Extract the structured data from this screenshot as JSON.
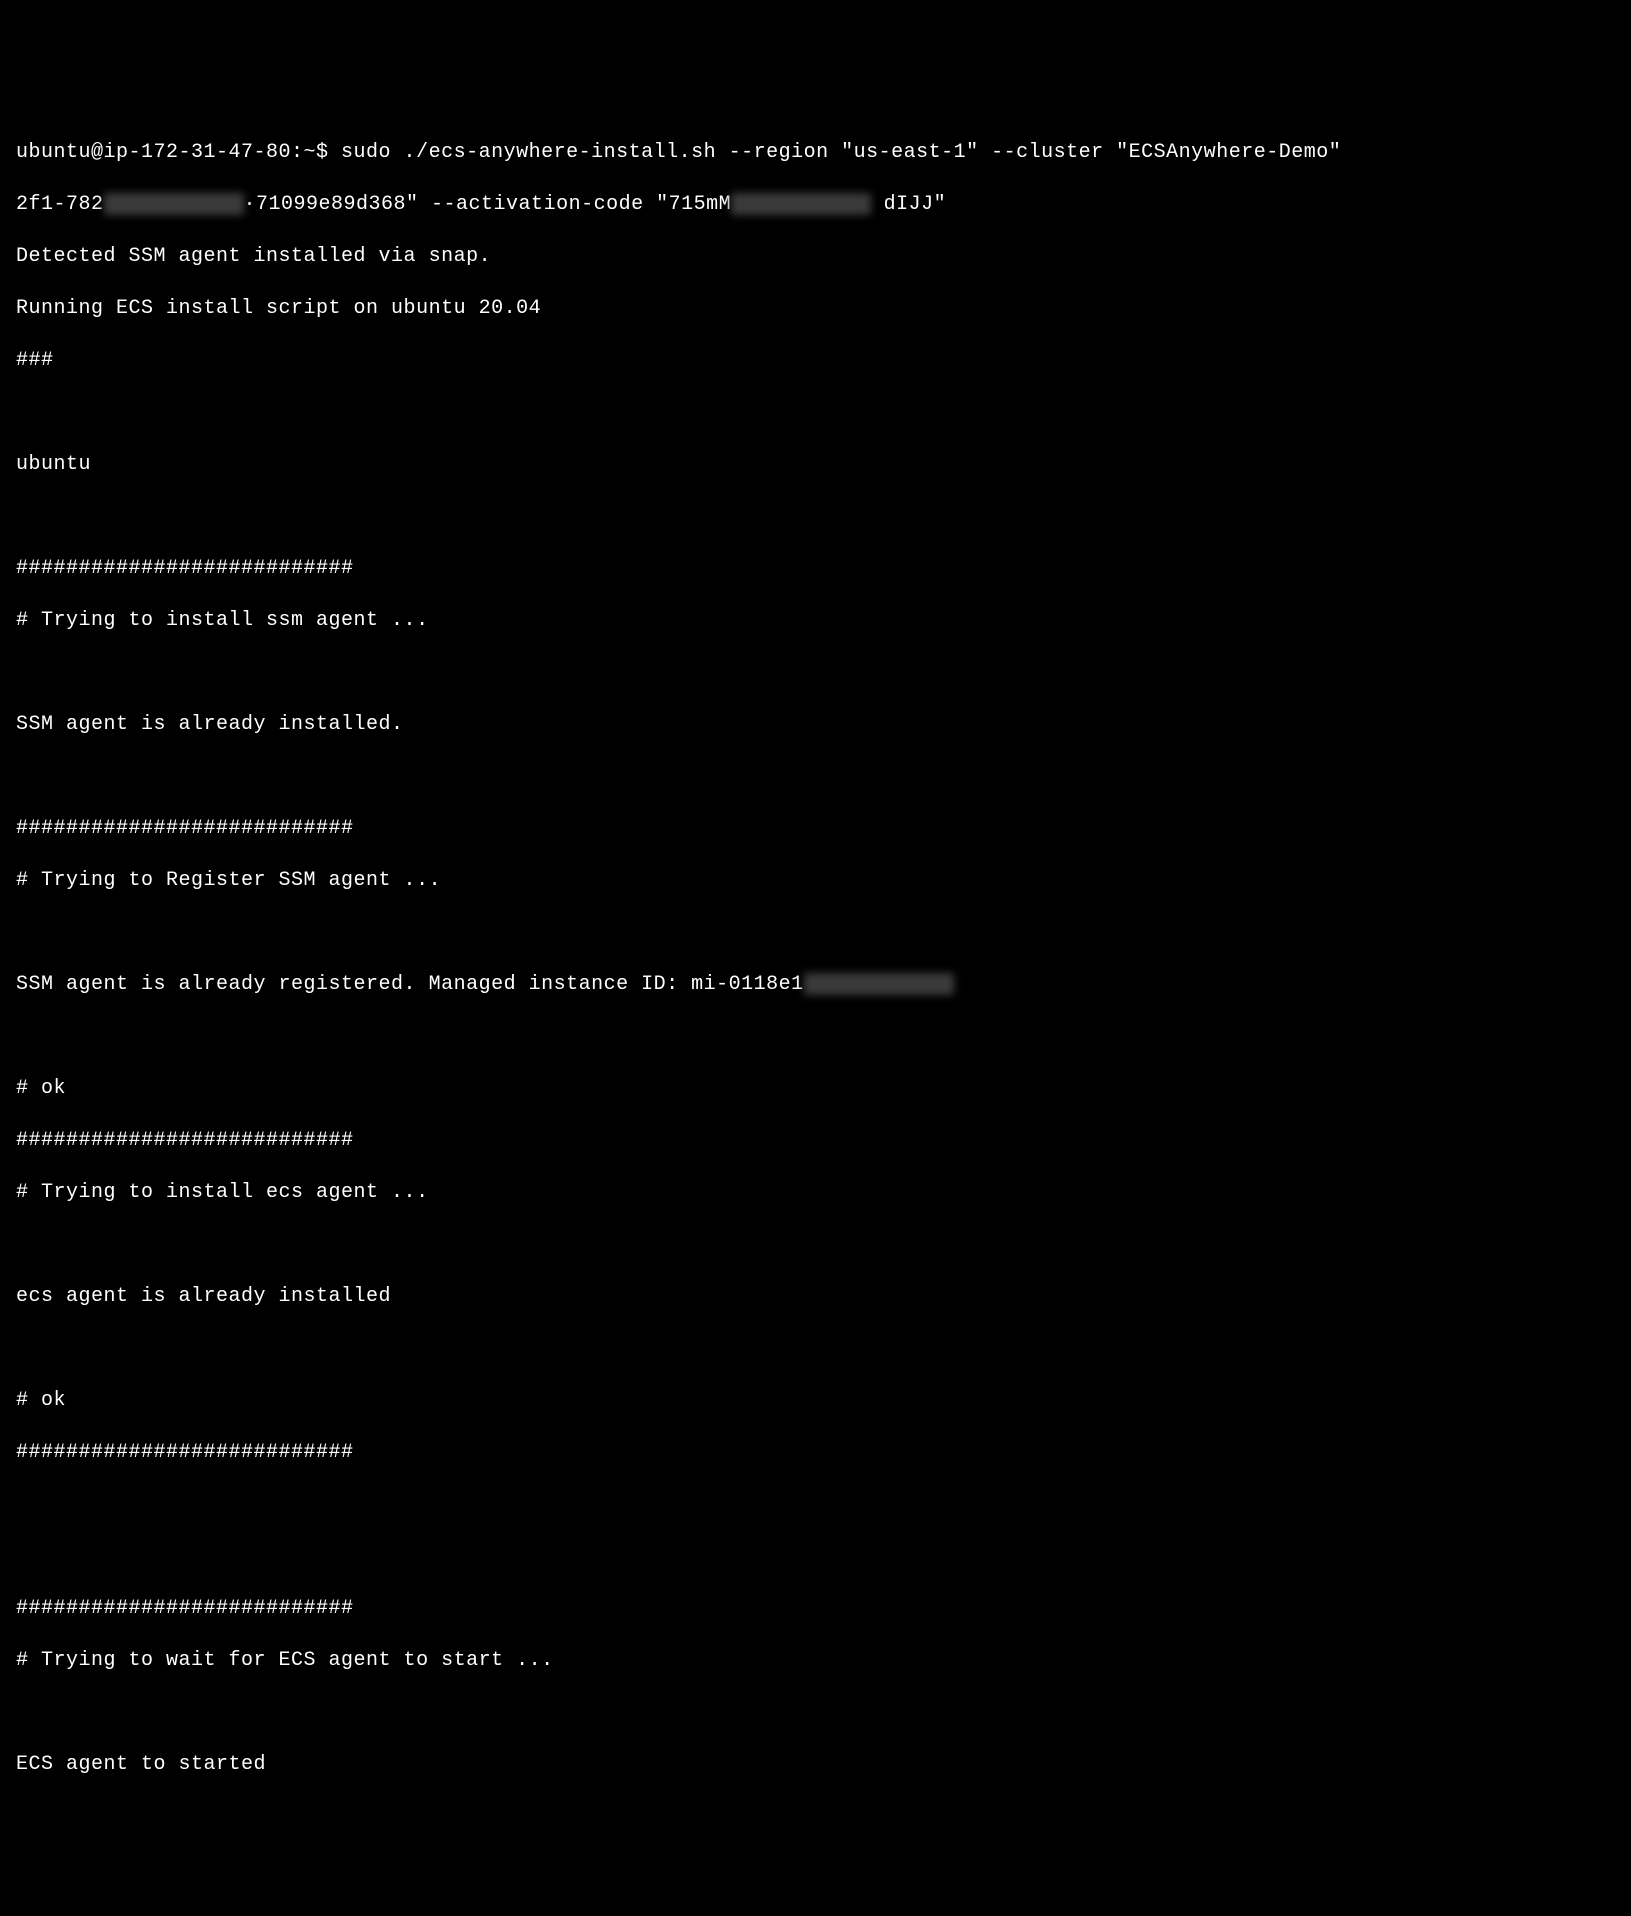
{
  "prompt_line1": "ubuntu@ip-172-31-47-80:~$ sudo ./ecs-anywhere-install.sh --region \"us-east-1\" --cluster \"ECSAnywhere-Demo\"",
  "prompt_line2a": "2f1-782",
  "prompt_line2b": "·71099e89d368\" --activation-code \"715mM",
  "prompt_line2c": " dIJJ\"",
  "detected": "Detected SSM agent installed via snap.",
  "running": "Running ECS install script on ubuntu 20.04",
  "hashes3": "###",
  "ubuntu_label": "ubuntu",
  "sep1": "###########################",
  "ssm_install_title": "# Trying to install ssm agent ...",
  "ssm_installed": "SSM agent is already installed.",
  "sep2": "###########################",
  "ssm_register_title": "# Trying to Register SSM agent ...",
  "ssm_registered_a": "SSM agent is already registered. Managed instance ID: mi-0118e1",
  "ok1": "# ok",
  "sep3": "###########################",
  "ecs_install_title": "# Trying to install ecs agent ...",
  "ecs_installed": "ecs agent is already installed",
  "ok2": "# ok",
  "sep4": "###########################",
  "sep5": "###########################",
  "ecs_wait_title": "# Trying to wait for ECS agent to start ...",
  "ecs_started": "ECS agent to started"
}
